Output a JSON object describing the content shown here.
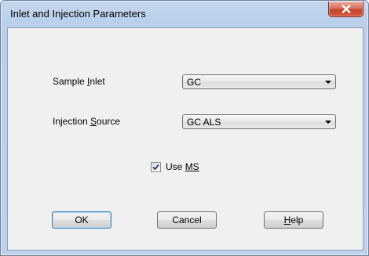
{
  "window": {
    "title": "Inlet and Injection Parameters"
  },
  "form": {
    "sample_inlet": {
      "label_before": "Sample ",
      "label_mnemonic": "I",
      "label_after": "nlet",
      "value": "GC"
    },
    "injection_source": {
      "label_before": "Injection ",
      "label_mnemonic": "S",
      "label_after": "ource",
      "value": "GC ALS"
    },
    "use_ms": {
      "label_before": "Use ",
      "label_mnemonic": "MS",
      "label_after": "",
      "checked": true
    }
  },
  "buttons": {
    "ok": "OK",
    "cancel": "Cancel",
    "help_mnemonic": "H",
    "help_rest": "elp"
  },
  "icons": {
    "close": "close-x-icon",
    "dropdown": "chevron-down-icon",
    "check": "checkmark-icon"
  },
  "colors": {
    "frame": "#bcd1ea",
    "client": "#f0f0f0",
    "close_button": "#c8462b",
    "default_button_border": "#3c7fb1"
  }
}
